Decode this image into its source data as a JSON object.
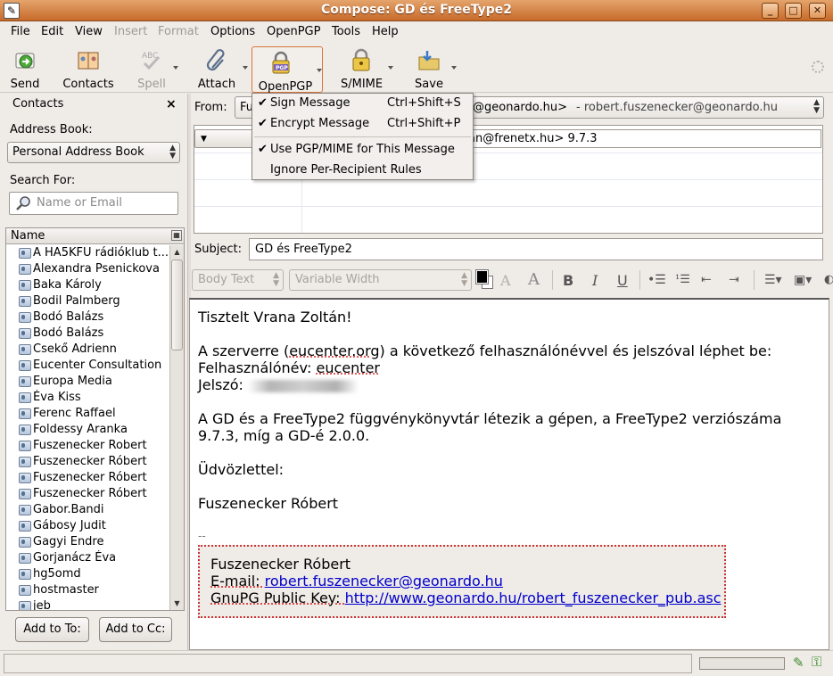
{
  "window": {
    "title": "Compose: GD és FreeType2"
  },
  "menubar": [
    {
      "label": "File",
      "enabled": true
    },
    {
      "label": "Edit",
      "enabled": true
    },
    {
      "label": "View",
      "enabled": true
    },
    {
      "label": "Insert",
      "enabled": false
    },
    {
      "label": "Format",
      "enabled": false
    },
    {
      "label": "Options",
      "enabled": true
    },
    {
      "label": "OpenPGP",
      "enabled": true
    },
    {
      "label": "Tools",
      "enabled": true
    },
    {
      "label": "Help",
      "enabled": true
    }
  ],
  "toolbar": {
    "send": "Send",
    "contacts": "Contacts",
    "spell": "Spell",
    "attach": "Attach",
    "openpgp": "OpenPGP",
    "smime": "S/MIME",
    "save": "Save"
  },
  "sidebar": {
    "header": "Contacts",
    "address_book_label": "Address Book:",
    "address_book_value": "Personal Address Book",
    "search_label": "Search For:",
    "search_placeholder": "Name or Email",
    "column_name": "Name",
    "contacts": [
      "A HA5KFU rádióklub t...",
      "Alexandra Psenickova",
      "Baka Károly",
      "Bodil Palmberg",
      "Bodó Balázs",
      "Bodó Balázs",
      "Csekő Adrienn",
      "Eucenter Consultation",
      "Europa Media",
      "Éva Kiss",
      "Ferenc Raffael",
      "Foldessy Aranka",
      "Fuszenecker Robert",
      "Fuszenecker Róbert",
      "Fuszenecker Róbert",
      "Fuszenecker Róbert",
      "Gabor.Bandi",
      "Gábosy Judit",
      "Gagyi Endre",
      "Gorjanácz Éva",
      "hg5omd",
      "hostmaster",
      "jeb"
    ],
    "add_to": "Add to To:",
    "add_to_cc": "Add to Cc:"
  },
  "compose": {
    "from_label": "From:",
    "from_prefix": "Fu",
    "from_value": "@geonardo.hu>",
    "from_account": "- robert.fuszenecker@geonardo.hu",
    "to_value": "an@frenetx.hu> 9.7.3",
    "subject_label": "Subject:",
    "subject_value": "GD és FreeType2"
  },
  "format_bar": {
    "paragraph_style": "Body Text",
    "font": "Variable Width",
    "text_color": "#000000",
    "background_color": "#ffffff"
  },
  "openpgp_menu": [
    {
      "label": "Sign Message",
      "shortcut": "Ctrl+Shift+S",
      "checked": true
    },
    {
      "label": "Encrypt Message",
      "shortcut": "Ctrl+Shift+P",
      "checked": true
    },
    {
      "label": "Use PGP/MIME for This Message",
      "shortcut": "",
      "checked": true
    },
    {
      "label": "Ignore Per-Recipient Rules",
      "shortcut": "",
      "checked": false
    }
  ],
  "message": {
    "greeting": "Tisztelt Vrana Zoltán!",
    "line1_before": "A szerverre (",
    "line1_link": "eucenter.org",
    "line1_after": ") a következő felhasználónévvel és jelszóval léphet be:",
    "username_label": "Felhasználónév: ",
    "username_value": "eucenter",
    "password_label": "Jelszó: ",
    "para2_line1": "A GD és a FreeType2 függvénykönyvtár létezik a gépen, a FreeType2 verziószáma",
    "para2_line2": "9.7.3, míg a GD-é 2.0.0.",
    "closing": "Üdvözlettel:",
    "name": "Fuszenecker Róbert",
    "sig_separator": "--",
    "sig_name": "Fuszenecker Róbert",
    "sig_email_label": "E-mail: ",
    "sig_email": "robert.fuszenecker@geonardo.hu",
    "sig_key_label": "GnuPG Public Key: ",
    "sig_key_url": "http://www.geonardo.hu/robert_fuszenecker_pub.asc"
  },
  "colors": {
    "titlebar": "#c76a2a",
    "link": "#0000cc",
    "signature_border": "#cc3333"
  }
}
